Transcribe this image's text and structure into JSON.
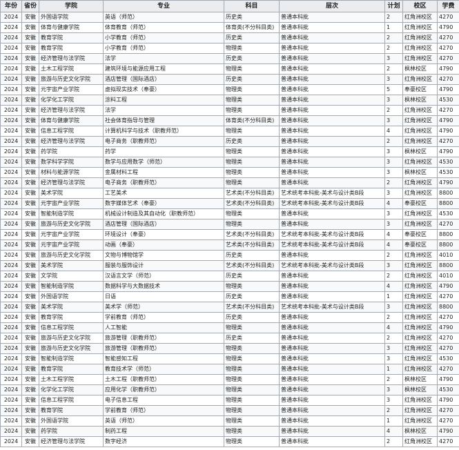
{
  "table": {
    "headers": [
      "年份",
      "省份",
      "学院",
      "专业",
      "科目",
      "层次",
      "计划",
      "校区",
      "学费"
    ],
    "rows": [
      [
        "2024",
        "安徽",
        "外国语学院",
        "英语（师范）",
        "历史类",
        "普通本科批",
        "2",
        "红角洲校区",
        "4270"
      ],
      [
        "2024",
        "安徽",
        "体育与健康学院",
        "体育教育（师范）",
        "体育类(不分科目类)",
        "普通本科批",
        "1",
        "红角洲校区",
        "4790"
      ],
      [
        "2024",
        "安徽",
        "教育学院",
        "小学教育（师范）",
        "历史类",
        "普通本科批",
        "2",
        "红角洲校区",
        "4270"
      ],
      [
        "2024",
        "安徽",
        "教育学院",
        "小学教育（师范）",
        "物理类",
        "普通本科批",
        "2",
        "红角洲校区",
        "4270"
      ],
      [
        "2024",
        "安徽",
        "经济管理与法学院",
        "法学",
        "历史类",
        "普通本科批",
        "3",
        "红角洲校区",
        "4270"
      ],
      [
        "2024",
        "安徽",
        "土木工程学院",
        "建筑环境与能源应用工程",
        "物理类",
        "普通本科批",
        "2",
        "枫林校区",
        "4790"
      ],
      [
        "2024",
        "安徽",
        "旅游与历史文化学院",
        "酒店管理（国际酒店）",
        "历史类",
        "普通本科批",
        "3",
        "红角洲校区",
        "4270"
      ],
      [
        "2024",
        "安徽",
        "元宇宙产业学院",
        "虚拟现实技术（奉豪）",
        "物理类",
        "普通本科批",
        "5",
        "奉豪校区",
        "4790"
      ],
      [
        "2024",
        "安徽",
        "化学化工学院",
        "涂料工程",
        "物理类",
        "普通本科批",
        "3",
        "枫林校区",
        "4530"
      ],
      [
        "2024",
        "安徽",
        "经济管理与法学院",
        "法学",
        "物理类",
        "普通本科批",
        "2",
        "红角洲校区",
        "4270"
      ],
      [
        "2024",
        "安徽",
        "体育与健康学院",
        "社会体育指导与管理",
        "体育类(不分科目类)",
        "普通本科批",
        "3",
        "红角洲校区",
        "4790"
      ],
      [
        "2024",
        "安徽",
        "信息工程学院",
        "计算机科学与技术（职教师范）",
        "物理类",
        "普通本科批",
        "4",
        "红角洲校区",
        "4790"
      ],
      [
        "2024",
        "安徽",
        "经济管理与法学院",
        "电子商务（职教师范）",
        "历史类",
        "普通本科批",
        "2",
        "红角洲校区",
        "4270"
      ],
      [
        "2024",
        "安徽",
        "药学院",
        "药学",
        "物理类",
        "普通本科批",
        "3",
        "枫林校区",
        "4790"
      ],
      [
        "2024",
        "安徽",
        "数学科学学院",
        "数学与应用数学（师范）",
        "物理类",
        "普通本科批",
        "3",
        "红角洲校区",
        "4530"
      ],
      [
        "2024",
        "安徽",
        "材料与能源学院",
        "金属材料工程",
        "物理类",
        "普通本科批",
        "3",
        "枫林校区",
        "4530"
      ],
      [
        "2024",
        "安徽",
        "经济管理与法学院",
        "电子商务（职教师范）",
        "物理类",
        "普通本科批",
        "2",
        "红角洲校区",
        "4790"
      ],
      [
        "2024",
        "安徽",
        "美术学院",
        "工艺美术",
        "艺术类(不分科目类)",
        "艺术统考本科批-美术与设计类B段",
        "3",
        "红角洲校区",
        "8800"
      ],
      [
        "2024",
        "安徽",
        "元宇宙产业学院",
        "数字媒体艺术（奉豪）",
        "艺术类(不分科目类)",
        "艺术统考本科批-美术与设计类B段",
        "4",
        "奉豪校区",
        "8800"
      ],
      [
        "2024",
        "安徽",
        "智能制造学院",
        "机械设计制造及其自动化（职教师范）",
        "物理类",
        "普通本科批",
        "3",
        "红角洲校区",
        "4530"
      ],
      [
        "2024",
        "安徽",
        "旅游与历史文化学院",
        "酒店管理（国际酒店）",
        "物理类",
        "普通本科批",
        "3",
        "红角洲校区",
        "4270"
      ],
      [
        "2024",
        "安徽",
        "元宇宙产业学院",
        "环境设计（奉豪）",
        "艺术类(不分科目类)",
        "艺术统考本科批-美术与设计类B段",
        "4",
        "奉豪校区",
        "8800"
      ],
      [
        "2024",
        "安徽",
        "元宇宙产业学院",
        "动画（奉豪）",
        "艺术类(不分科目类)",
        "艺术统考本科批-美术与设计类B段",
        "4",
        "奉豪校区",
        "8800"
      ],
      [
        "2024",
        "安徽",
        "旅游与历史文化学院",
        "文物与博物馆学",
        "历史类",
        "普通本科批",
        "2",
        "红角洲校区",
        "4010"
      ],
      [
        "2024",
        "安徽",
        "美术学院",
        "服装与服饰设计",
        "艺术类(不分科目类)",
        "艺术统考本科批-美术与设计类B段",
        "3",
        "红角洲校区",
        "8800"
      ],
      [
        "2024",
        "安徽",
        "文学院",
        "汉语言文学（师范）",
        "历史类",
        "普通本科批",
        "2",
        "红角洲校区",
        "4010"
      ],
      [
        "2024",
        "安徽",
        "智能制造学院",
        "数据科学与大数据技术",
        "物理类",
        "普通本科批",
        "4",
        "红角洲校区",
        "4790"
      ],
      [
        "2024",
        "安徽",
        "外国语学院",
        "日语",
        "历史类",
        "普通本科批",
        "1",
        "红角洲校区",
        "4270"
      ],
      [
        "2024",
        "安徽",
        "美术学院",
        "美术学（师范）",
        "艺术类(不分科目类)",
        "艺术统考本科批-美术与设计类B段",
        "3",
        "红角洲校区",
        "8800"
      ],
      [
        "2024",
        "安徽",
        "教育学院",
        "学前教育（师范）",
        "历史类",
        "普通本科批",
        "2",
        "红角洲校区",
        "4270"
      ],
      [
        "2024",
        "安徽",
        "信息工程学院",
        "人工智能",
        "物理类",
        "普通本科批",
        "4",
        "红角洲校区",
        "4790"
      ],
      [
        "2024",
        "安徽",
        "旅游与历史文化学院",
        "旅游管理（职教师范）",
        "历史类",
        "普通本科批",
        "2",
        "红角洲校区",
        "4270"
      ],
      [
        "2024",
        "安徽",
        "旅游与历史文化学院",
        "旅游管理（职教师范）",
        "物理类",
        "普通本科批",
        "3",
        "红角洲校区",
        "4270"
      ],
      [
        "2024",
        "安徽",
        "智能制造学院",
        "智能感知工程",
        "物理类",
        "普通本科批",
        "3",
        "红角洲校区",
        "4530"
      ],
      [
        "2024",
        "安徽",
        "教育学院",
        "教育技术学（师范）",
        "物理类",
        "普通本科批",
        "1",
        "红角洲校区",
        "4270"
      ],
      [
        "2024",
        "安徽",
        "土木工程学院",
        "土木工程（职教师范）",
        "物理类",
        "普通本科批",
        "2",
        "枫林校区",
        "4790"
      ],
      [
        "2024",
        "安徽",
        "化学化工学院",
        "应用化学（职教师范）",
        "物理类",
        "普通本科批",
        "3",
        "枫林校区",
        "4530"
      ],
      [
        "2024",
        "安徽",
        "信息工程学院",
        "电子信息工程",
        "物理类",
        "普通本科批",
        "3",
        "红角洲校区",
        "4790"
      ],
      [
        "2024",
        "安徽",
        "教育学院",
        "学前教育（师范）",
        "物理类",
        "普通本科批",
        "2",
        "红角洲校区",
        "4270"
      ],
      [
        "2024",
        "安徽",
        "外国语学院",
        "英语（师范）",
        "物理类",
        "普通本科批",
        "1",
        "红角洲校区",
        "4270"
      ],
      [
        "2024",
        "安徽",
        "药学院",
        "制药工程",
        "物理类",
        "普通本科批",
        "4",
        "枫林校区",
        "4790"
      ],
      [
        "2024",
        "安徽",
        "经济管理与法学院",
        "数字经济",
        "物理类",
        "普通本科批",
        "2",
        "红角洲校区",
        "4270"
      ]
    ]
  }
}
